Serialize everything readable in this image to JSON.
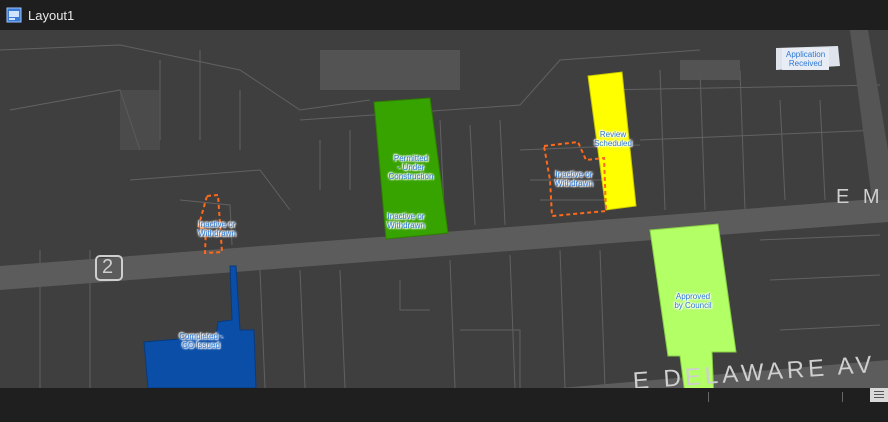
{
  "window": {
    "title": "Layout1"
  },
  "colors": {
    "titlebar": "#1e1e1e",
    "map_bg": "#3f3f3f",
    "road": "#5a5a5a",
    "parcel_line": "#7a7a7a",
    "permitted": "#37a300",
    "review": "#ffff00",
    "approved": "#b3ff66",
    "completed": "#0a4ea8",
    "inactive_outline": "#ff6a1a",
    "label_text": "#2a78d4"
  },
  "map": {
    "street_labels": {
      "route": "2",
      "east": "E M",
      "avenue": "E DELAWARE AV"
    },
    "parcels": {
      "application_received": "Application\nReceived",
      "review_scheduled": "Review\nScheduled",
      "permitted": "Permitted\n- Under\nConstruction",
      "inactive_a": "Inactive or\nWithdrawn",
      "inactive_b": "Inactive or\nWithdrawn",
      "inactive_c": "Inactive or\nWithdrawn",
      "approved": "Approved\nby Council",
      "completed": "Completed -\nCO Issued"
    }
  }
}
